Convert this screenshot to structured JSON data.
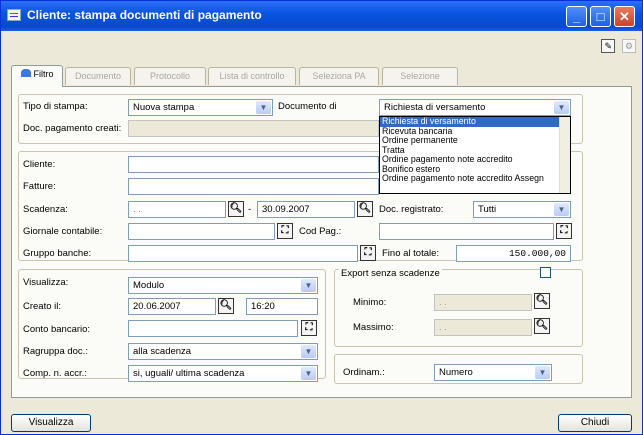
{
  "window": {
    "title": "Cliente: stampa documenti di pagamento"
  },
  "titlebar_buttons": {
    "minimize": "_",
    "maximize": "□",
    "close": "✕"
  },
  "tabs": [
    {
      "label": "Filtro",
      "active": true
    },
    {
      "label": "Documento"
    },
    {
      "label": "Protocollo"
    },
    {
      "label": "Lista di controllo"
    },
    {
      "label": "Seleziona PA"
    },
    {
      "label": "Selezione"
    }
  ],
  "filter": {
    "tipo_stampa_label": "Tipo di stampa:",
    "tipo_stampa_value": "Nuova stampa",
    "documento_di_label": "Documento di",
    "documento_di_value": "Richiesta di versamento",
    "doc_creati_label": "Doc. pagamento creati:"
  },
  "documento_options": [
    "Richiesta di versamento",
    "Ricevuta bancaria",
    "Ordine permanente",
    "Tratta",
    "Ordine pagamento note accredito",
    "Bonifico estero",
    "Ordine pagamento note accredito Assegn"
  ],
  "main": {
    "cliente_label": "Cliente:",
    "fatture_label": "Fatture:",
    "scadenza_label": "Scadenza:",
    "scadenza_from": ". .",
    "scadenza_sep": "-",
    "scadenza_to": "30.09.2007",
    "doc_registrato_label": "Doc. registrato:",
    "doc_registrato_value": "Tutti",
    "giornale_label": "Giornale contabile:",
    "cod_pag_label": "Cod Pag.:",
    "gruppo_label": "Gruppo banche:",
    "fino_totale_label": "Fino al totale:",
    "fino_totale_value": "150.000,00"
  },
  "visualizza_group": {
    "visualizza_label": "Visualizza:",
    "visualizza_value": "Modulo",
    "creato_label": "Creato il:",
    "creato_date": "20.06.2007",
    "creato_time": "16:20",
    "conto_label": "Conto bancario:",
    "raggruppa_label": "Ragruppa doc.:",
    "raggruppa_value": "alla scadenza",
    "comp_label": "Comp. n. accr.:",
    "comp_value": "si, uguali/ ultima scadenza"
  },
  "export_group": {
    "export_label": "Export senza scadenze",
    "minimo_label": "Minimo:",
    "minimo_value": ". .",
    "massimo_label": "Massimo:",
    "massimo_value": ". ."
  },
  "ordinam": {
    "label": "Ordinam.:",
    "value": "Numero"
  },
  "footer": {
    "visualizza_btn": "Visualizza",
    "chiudi_btn": "Chiudi"
  },
  "icons": {
    "search": "search-icon",
    "lookup": "lookup-icon",
    "dropdown": "chevron-down-icon"
  }
}
